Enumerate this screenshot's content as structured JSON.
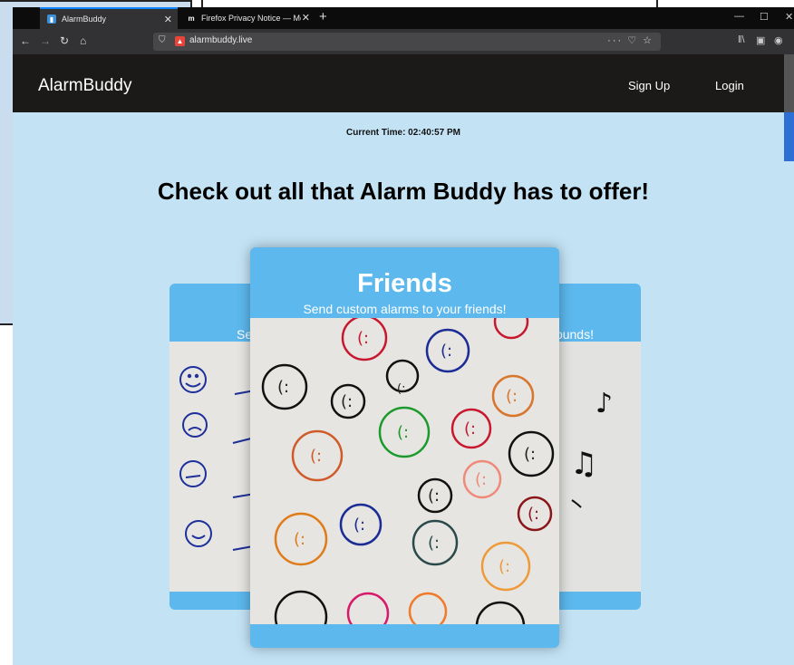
{
  "browser": {
    "tabs": [
      {
        "title": "AlarmBuddy",
        "active": true
      },
      {
        "title": "Firefox Privacy Notice — Mozil",
        "active": false
      }
    ],
    "url": "alarmbuddy.live"
  },
  "site": {
    "brand": "AlarmBuddy",
    "nav": {
      "signup": "Sign Up",
      "login": "Login"
    },
    "current_time": "Current Time: 02:40:57 PM",
    "headline": "Check out all that Alarm Buddy has to offer!",
    "cards": {
      "front": {
        "title": "Friends",
        "subtitle": "Send custom alarms to your friends!"
      },
      "left": {
        "subtitle_fragment": "Se"
      },
      "right": {
        "subtitle_fragment": "ounds!"
      }
    }
  },
  "colors": {
    "page_bg": "#c3e3f5",
    "navbar_bg": "#1c1919",
    "card_bg": "#5cb8ed"
  }
}
